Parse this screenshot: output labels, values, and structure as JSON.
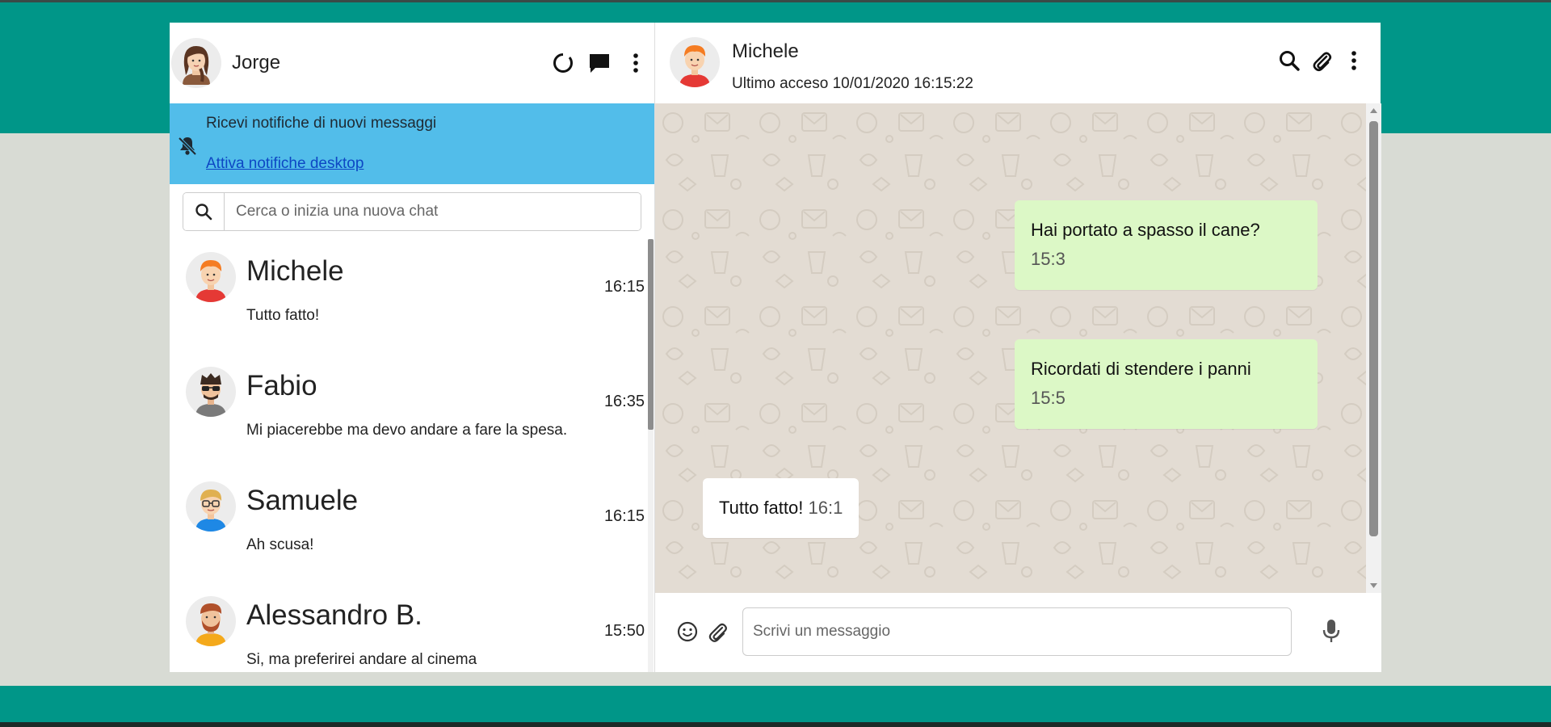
{
  "colors": {
    "accent": "#009688",
    "notify_bg": "#52bdea",
    "outgoing_bubble": "#dcf8c6",
    "incoming_bubble": "#ffffff",
    "chat_bg": "#e3dcd3",
    "page_bg": "#d8dbd4"
  },
  "me": {
    "name": "Jorge",
    "avatar_icon": "user-avatar-woman-icon"
  },
  "left_header_icons": [
    "status-ring-icon",
    "new-chat-icon",
    "menu-vertical-icon"
  ],
  "notification": {
    "icon": "bell-off-icon",
    "title": "Ricevi notifiche di nuovi messaggi",
    "link": "Attiva notifiche desktop"
  },
  "search": {
    "placeholder": "Cerca o inizia una nuova chat",
    "icon": "search-icon"
  },
  "chats": [
    {
      "name": "Michele",
      "last_message": "Tutto fatto!",
      "time": "16:15",
      "avatar_icon": "avatar-red-hair-icon"
    },
    {
      "name": "Fabio",
      "last_message": "Mi piacerebbe ma devo andare a fare la spesa.",
      "time": "16:35",
      "avatar_icon": "avatar-sunglasses-icon"
    },
    {
      "name": "Samuele",
      "last_message": "Ah scusa!",
      "time": "16:15",
      "avatar_icon": "avatar-glasses-icon"
    },
    {
      "name": "Alessandro B.",
      "last_message": "Si, ma preferirei andare al cinema",
      "time": "15:50",
      "avatar_icon": "avatar-beard-icon"
    }
  ],
  "active_chat": {
    "name": "Michele",
    "status": "Ultimo acceso 10/01/2020 16:15:22",
    "icons": [
      "search-icon",
      "paperclip-icon",
      "menu-vertical-icon"
    ]
  },
  "messages": [
    {
      "direction": "sent",
      "text": "Hai portato a spasso il cane?",
      "time": "15:3"
    },
    {
      "direction": "sent",
      "text": "Ricordati di stendere i panni",
      "time": "15:5"
    },
    {
      "direction": "received",
      "text": "Tutto fatto!",
      "time": "16:1"
    }
  ],
  "composer": {
    "placeholder": "Scrivi un messaggio",
    "icons": [
      "emoji-icon",
      "paperclip-icon",
      "microphone-icon"
    ]
  }
}
